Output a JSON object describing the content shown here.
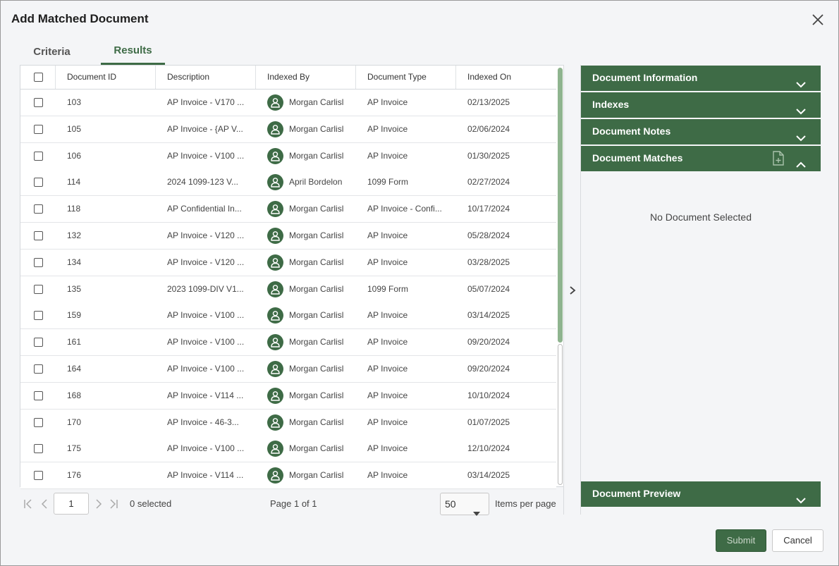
{
  "dialog": {
    "title": "Add Matched Document",
    "close_icon": "close-icon"
  },
  "tabs": [
    {
      "label": "Criteria",
      "active": false
    },
    {
      "label": "Results",
      "active": true
    }
  ],
  "table": {
    "columns": [
      "Document ID",
      "Description",
      "Indexed By",
      "Document Type",
      "Indexed On"
    ],
    "rows": [
      {
        "id": "103",
        "desc": "AP Invoice - V170 ...",
        "by": "Morgan Carlisl",
        "type": "AP Invoice",
        "on": "02/13/2025"
      },
      {
        "id": "105",
        "desc": "AP Invoice - {AP V...",
        "by": "Morgan Carlisl",
        "type": "AP Invoice",
        "on": "02/06/2024"
      },
      {
        "id": "106",
        "desc": "AP Invoice - V100 ...",
        "by": "Morgan Carlisl",
        "type": "AP Invoice",
        "on": "01/30/2025"
      },
      {
        "id": "114",
        "desc": "2024 1099-123 V...",
        "by": "April Bordelon",
        "type": "1099 Form",
        "on": "02/27/2024"
      },
      {
        "id": "118",
        "desc": "AP Confidential In...",
        "by": "Morgan Carlisl",
        "type": "AP Invoice - Confi...",
        "on": "10/17/2024"
      },
      {
        "id": "132",
        "desc": "AP Invoice - V120 ...",
        "by": "Morgan Carlisl",
        "type": "AP Invoice",
        "on": "05/28/2024"
      },
      {
        "id": "134",
        "desc": "AP Invoice - V120 ...",
        "by": "Morgan Carlisl",
        "type": "AP Invoice",
        "on": "03/28/2025"
      },
      {
        "id": "135",
        "desc": "2023 1099-DIV V1...",
        "by": "Morgan Carlisl",
        "type": "1099 Form",
        "on": "05/07/2024"
      },
      {
        "id": "159",
        "desc": "AP Invoice - V100 ...",
        "by": "Morgan Carlisl",
        "type": "AP Invoice",
        "on": "03/14/2025"
      },
      {
        "id": "161",
        "desc": "AP Invoice - V100 ...",
        "by": "Morgan Carlisl",
        "type": "AP Invoice",
        "on": "09/20/2024"
      },
      {
        "id": "164",
        "desc": "AP Invoice - V100 ...",
        "by": "Morgan Carlisl",
        "type": "AP Invoice",
        "on": "09/20/2024"
      },
      {
        "id": "168",
        "desc": "AP Invoice - V114 ...",
        "by": "Morgan Carlisl",
        "type": "AP Invoice",
        "on": "10/10/2024"
      },
      {
        "id": "170",
        "desc": "AP Invoice - 46-3...",
        "by": "Morgan Carlisl",
        "type": "AP Invoice",
        "on": "01/07/2025"
      },
      {
        "id": "175",
        "desc": "AP Invoice - V100 ...",
        "by": "Morgan Carlisl",
        "type": "AP Invoice",
        "on": "12/10/2024"
      },
      {
        "id": "176",
        "desc": "AP Invoice - V114 ...",
        "by": "Morgan Carlisl",
        "type": "AP Invoice",
        "on": "03/14/2025"
      }
    ]
  },
  "pager": {
    "page_input": "1",
    "selected_text": "0 selected",
    "page_text": "Page 1 of 1",
    "items_per_page_value": "50",
    "items_per_page_label": "Items per page"
  },
  "panels": {
    "document_information": "Document Information",
    "indexes": "Indexes",
    "document_notes": "Document Notes",
    "document_matches": "Document Matches",
    "no_document": "No Document Selected",
    "document_preview": "Document Preview"
  },
  "buttons": {
    "submit": "Submit",
    "cancel": "Cancel"
  },
  "colors": {
    "accent": "#3e6b46",
    "background": "#f4f5f7"
  }
}
